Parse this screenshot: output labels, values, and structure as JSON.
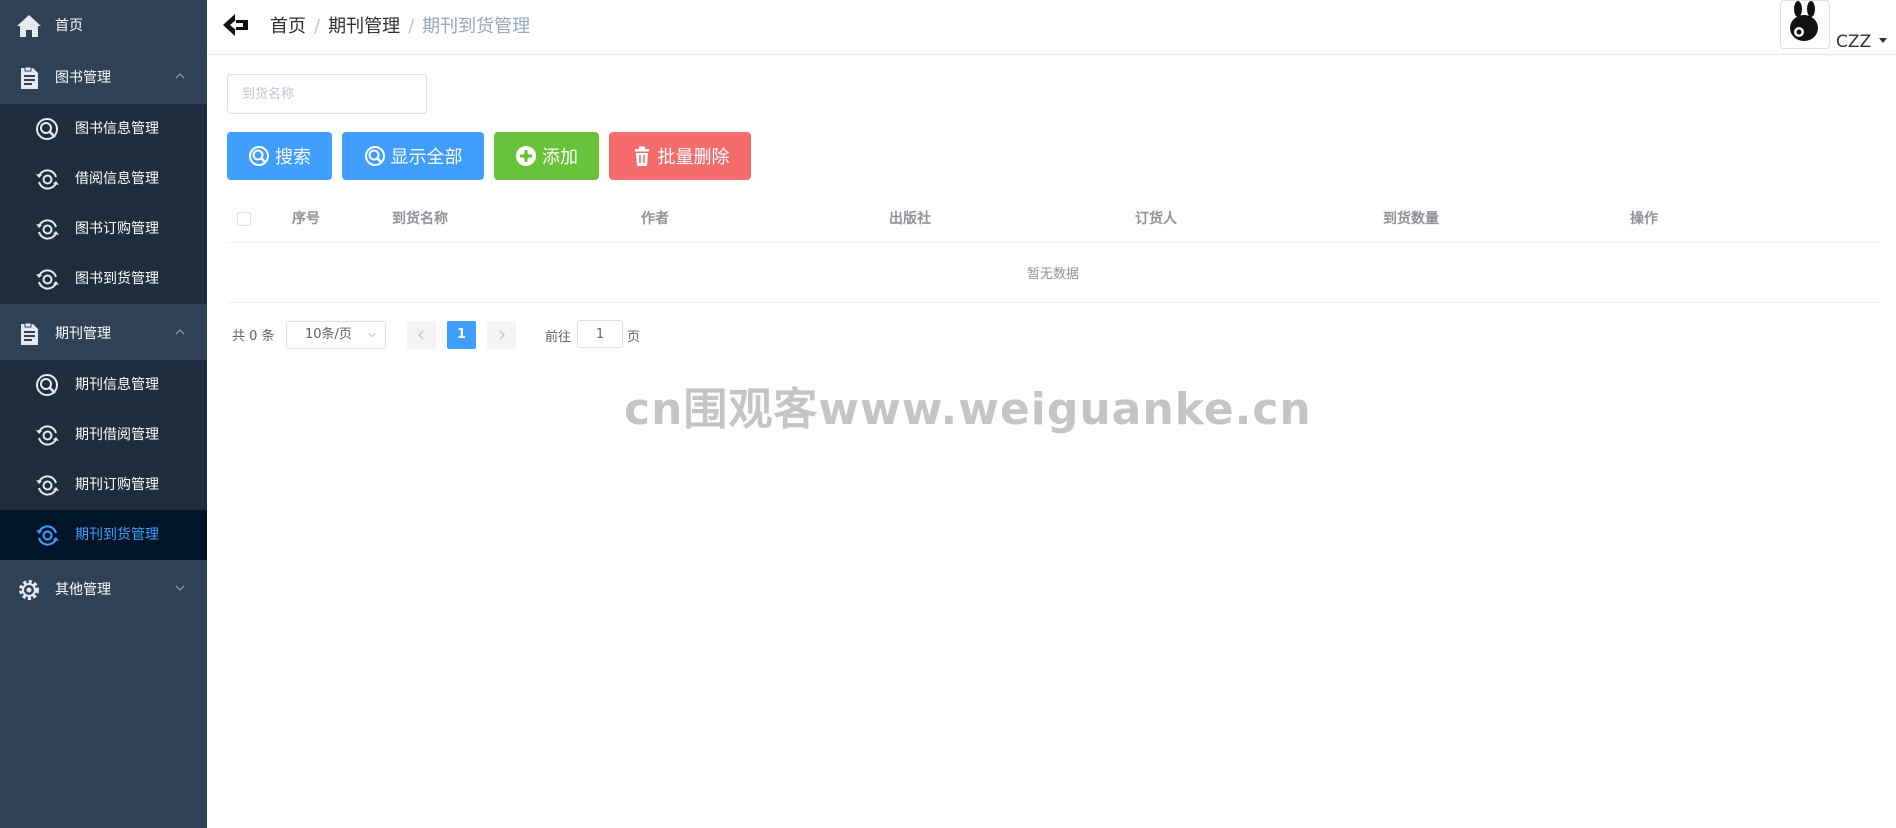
{
  "sidebar": {
    "home": {
      "label": "首页",
      "icon": "home-icon"
    },
    "groups": [
      {
        "label": "图书管理",
        "icon": "document-icon",
        "items": [
          {
            "label": "图书信息管理",
            "icon": "search-circle-icon"
          },
          {
            "label": "借阅信息管理",
            "icon": "sync-circle-icon"
          },
          {
            "label": "图书订购管理",
            "icon": "sync-circle-icon"
          },
          {
            "label": "图书到货管理",
            "icon": "sync-circle-icon"
          }
        ]
      },
      {
        "label": "期刊管理",
        "icon": "document-icon",
        "items": [
          {
            "label": "期刊信息管理",
            "icon": "search-circle-icon"
          },
          {
            "label": "期刊借阅管理",
            "icon": "sync-circle-icon"
          },
          {
            "label": "期刊订购管理",
            "icon": "sync-circle-icon"
          },
          {
            "label": "期刊到货管理",
            "icon": "sync-circle-icon",
            "active": true
          }
        ]
      },
      {
        "label": "其他管理",
        "icon": "gear-icon",
        "items": []
      }
    ]
  },
  "header": {
    "breadcrumb": [
      "首页",
      "期刊管理",
      "期刊到货管理"
    ],
    "separator": "/",
    "username": "CZZ"
  },
  "search": {
    "placeholder": "到货名称",
    "value": ""
  },
  "buttons": {
    "search": "搜索",
    "show_all": "显示全部",
    "add": "添加",
    "batch_delete": "批量删除"
  },
  "table": {
    "columns": [
      "序号",
      "到货名称",
      "作者",
      "出版社",
      "订货人",
      "到货数量",
      "操作"
    ],
    "rows": [],
    "empty_text": "暂无数据"
  },
  "pagination": {
    "total_text": "共 0 条",
    "page_size": "10条/页",
    "current_page": "1",
    "goto_label": "前往",
    "goto_value": "1",
    "goto_suffix": "页"
  },
  "watermark": "cn围观客www.weiguanke.cn",
  "colors": {
    "sidebar_bg": "#304156",
    "submenu_bg": "#1f2d3d",
    "active_item_bg": "#001528",
    "primary": "#409eff",
    "success": "#67c23a",
    "danger": "#f56c6c"
  }
}
